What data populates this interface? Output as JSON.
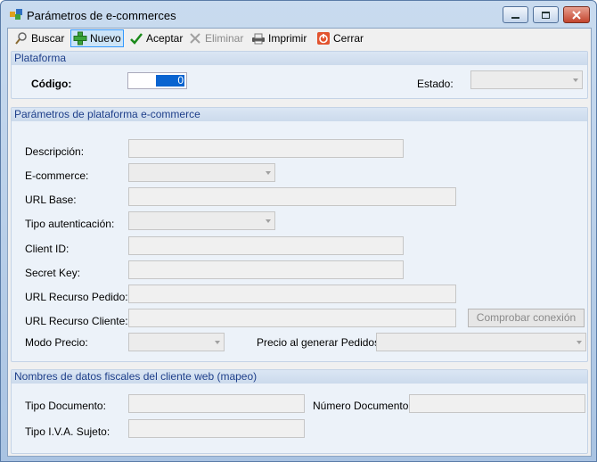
{
  "window": {
    "title": "Parámetros de e-commerces"
  },
  "toolbar": {
    "buscar": "Buscar",
    "nuevo": "Nuevo",
    "aceptar": "Aceptar",
    "eliminar": "Eliminar",
    "imprimir": "Imprimir",
    "cerrar": "Cerrar"
  },
  "plataforma": {
    "header": "Plataforma",
    "codigo_label": "Código:",
    "codigo_value": "0",
    "estado_label": "Estado:"
  },
  "parametros": {
    "header": "Parámetros de plataforma e-commerce",
    "descripcion": "Descripción:",
    "ecommerce": "E-commerce:",
    "url_base": "URL Base:",
    "tipo_autenticacion": "Tipo autenticación:",
    "client_id": "Client ID:",
    "secret_key": "Secret Key:",
    "url_recurso_pedido": "URL Recurso Pedido:",
    "url_recurso_cliente": "URL Recurso Cliente:",
    "comprobar_conexion": "Comprobar conexión",
    "modo_precio": "Modo Precio:",
    "precio_generar": "Precio al generar Pedidos:"
  },
  "fiscales": {
    "header": "Nombres de datos fiscales del cliente web (mapeo)",
    "tipo_documento": "Tipo Documento:",
    "numero_documento": "Número Documento:",
    "tipo_iva": "Tipo I.V.A. Sujeto:"
  },
  "colors": {
    "group_header_text": "#1e3f8a",
    "selection": "#0a64d0"
  }
}
